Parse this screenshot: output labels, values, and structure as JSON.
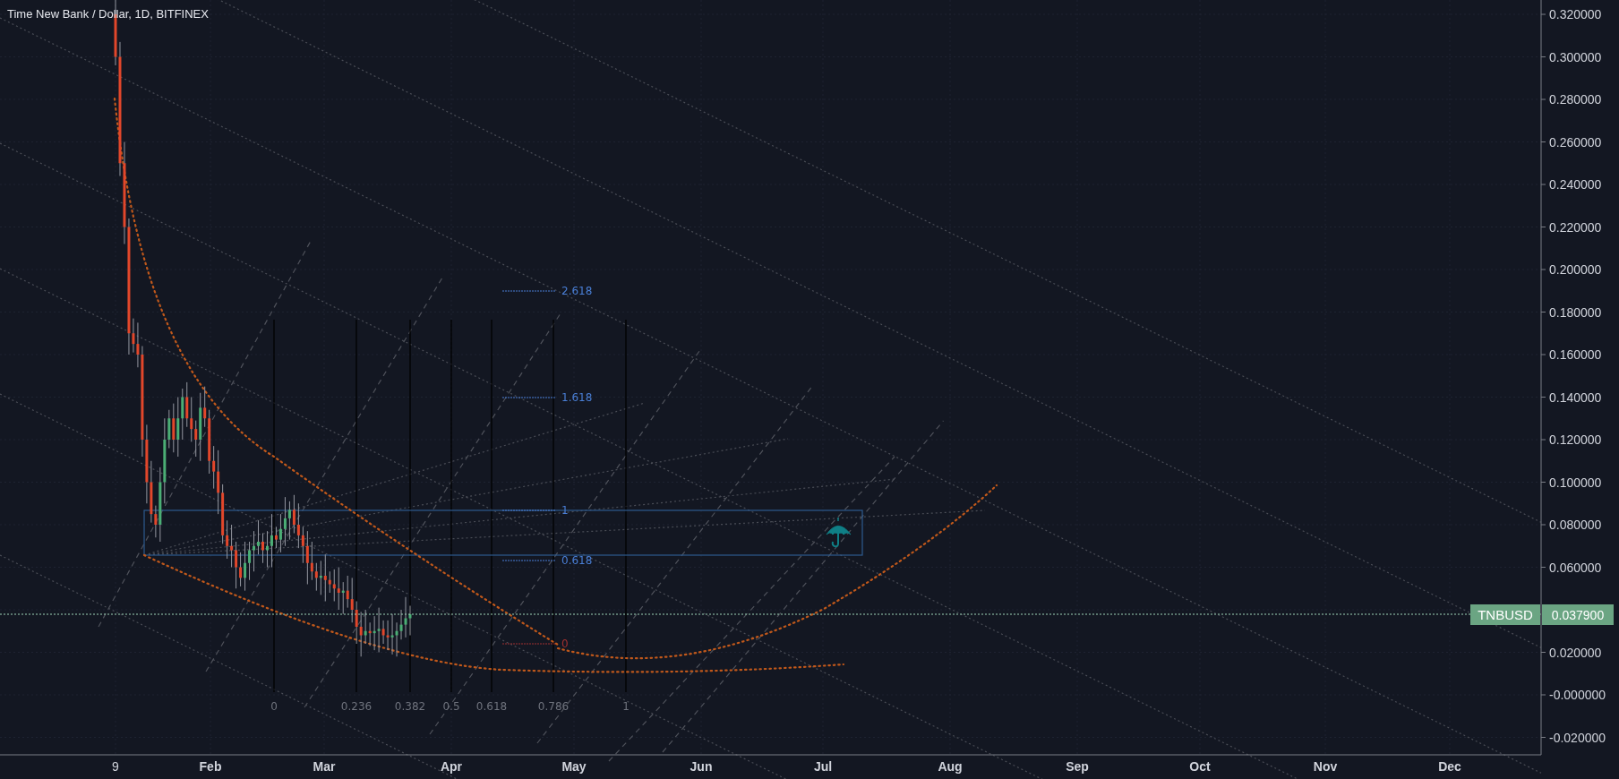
{
  "chart": {
    "title": "Time New Bank / Dollar, 1D, BITFINEX",
    "price_axis": {
      "labels": [
        "0.320000",
        "0.300000",
        "0.280000",
        "0.260000",
        "0.240000",
        "0.220000",
        "0.200000",
        "0.180000",
        "0.160000",
        "0.140000",
        "0.120000",
        "0.100000",
        "0.080000",
        "0.060000",
        "0.020000",
        "-0.000000",
        "-0.020000"
      ]
    },
    "time_axis": {
      "labels": [
        "9",
        "Feb",
        "Mar",
        "Apr",
        "May",
        "Jun",
        "Jul",
        "Aug",
        "Sep",
        "Oct",
        "Nov",
        "Dec"
      ]
    },
    "last_price": {
      "symbol": "TNBUSD",
      "value": "0.037900"
    },
    "fib_time_zones": {
      "labels": [
        "0",
        "0.236",
        "0.382",
        "0.5",
        "0.618",
        "0.786",
        "1"
      ]
    },
    "fib_levels": [
      {
        "label": "2.618",
        "color": "#4a7fd6"
      },
      {
        "label": "1.618",
        "color": "#4a7fd6"
      },
      {
        "label": "1",
        "color": "#4a7fd6"
      },
      {
        "label": "0.618",
        "color": "#4a7fd6"
      },
      {
        "label": "0",
        "color": "#a03030"
      }
    ]
  }
}
